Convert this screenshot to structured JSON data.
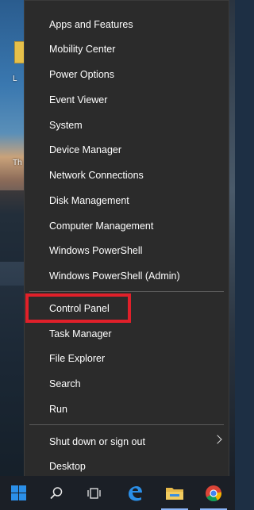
{
  "desktop": {
    "icon_label_partial_1": "L",
    "icon_label_partial_2": "Th"
  },
  "menu": {
    "group1": [
      {
        "label": "Apps and Features"
      },
      {
        "label": "Mobility Center"
      },
      {
        "label": "Power Options"
      },
      {
        "label": "Event Viewer"
      },
      {
        "label": "System"
      },
      {
        "label": "Device Manager"
      },
      {
        "label": "Network Connections"
      },
      {
        "label": "Disk Management"
      },
      {
        "label": "Computer Management"
      },
      {
        "label": "Windows PowerShell"
      },
      {
        "label": "Windows PowerShell (Admin)"
      }
    ],
    "group2": [
      {
        "label": "Control Panel"
      },
      {
        "label": "Task Manager"
      },
      {
        "label": "File Explorer"
      },
      {
        "label": "Search"
      },
      {
        "label": "Run"
      }
    ],
    "group3": [
      {
        "label": "Shut down or sign out"
      },
      {
        "label": "Desktop"
      }
    ],
    "highlighted_item": "Control Panel",
    "highlight_color": "#e0202a"
  },
  "taskbar": {
    "items": [
      "start-button",
      "search-icon",
      "task-view-icon",
      "edge-icon",
      "file-explorer-icon",
      "chrome-icon"
    ],
    "accent": "#2b8fe8"
  }
}
